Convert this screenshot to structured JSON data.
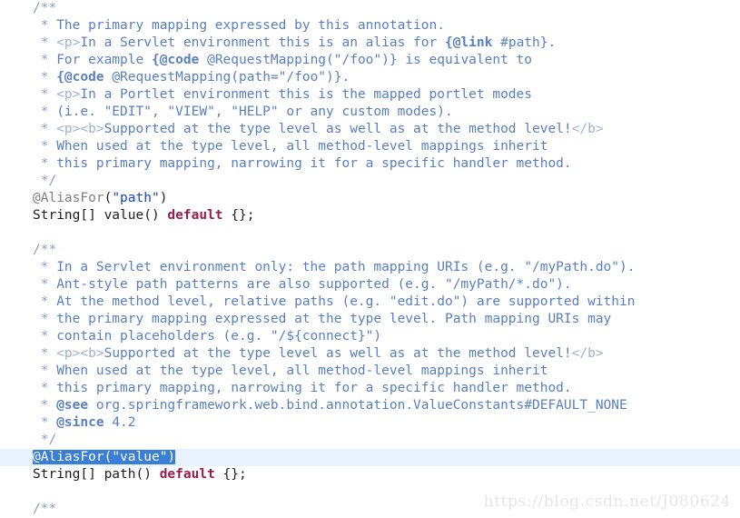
{
  "editor": {
    "language": "java",
    "background_color": "#ffffff",
    "current_line_highlight_color": "#e8f2fd",
    "selection_color": "#3a7fd5",
    "lines": [
      {
        "indent": 1,
        "segments": [
          {
            "cls": "cmt-delim",
            "text": "/**"
          }
        ]
      },
      {
        "indent": 1,
        "segments": [
          {
            "cls": "cmt-delim",
            "text": " * "
          },
          {
            "cls": "cmt",
            "text": "The primary mapping expressed by this annotation."
          }
        ]
      },
      {
        "indent": 1,
        "segments": [
          {
            "cls": "cmt-delim",
            "text": " * "
          },
          {
            "cls": "cmt-html",
            "text": "<p>"
          },
          {
            "cls": "cmt",
            "text": "In a Servlet environment this is an alias for "
          },
          {
            "cls": "cmt-tag",
            "text": "{@link"
          },
          {
            "cls": "cmt",
            "text": " #path}."
          }
        ]
      },
      {
        "indent": 1,
        "segments": [
          {
            "cls": "cmt-delim",
            "text": " * "
          },
          {
            "cls": "cmt",
            "text": "For example "
          },
          {
            "cls": "cmt-tag",
            "text": "{@code"
          },
          {
            "cls": "cmt",
            "text": " @RequestMapping(\"/foo\")} is equivalent to"
          }
        ]
      },
      {
        "indent": 1,
        "segments": [
          {
            "cls": "cmt-delim",
            "text": " * "
          },
          {
            "cls": "cmt-tag",
            "text": "{@code"
          },
          {
            "cls": "cmt",
            "text": " @RequestMapping(path=\"/foo\")}."
          }
        ]
      },
      {
        "indent": 1,
        "segments": [
          {
            "cls": "cmt-delim",
            "text": " * "
          },
          {
            "cls": "cmt-html",
            "text": "<p>"
          },
          {
            "cls": "cmt",
            "text": "In a Portlet environment this is the mapped portlet modes"
          }
        ]
      },
      {
        "indent": 1,
        "segments": [
          {
            "cls": "cmt-delim",
            "text": " * "
          },
          {
            "cls": "cmt",
            "text": "(i.e. \"EDIT\", \"VIEW\", \"HELP\" or any custom modes)."
          }
        ]
      },
      {
        "indent": 1,
        "segments": [
          {
            "cls": "cmt-delim",
            "text": " * "
          },
          {
            "cls": "cmt-html",
            "text": "<p><b>"
          },
          {
            "cls": "cmt",
            "text": "Supported at the type level as well as at the method level!"
          },
          {
            "cls": "cmt-html",
            "text": "</b>"
          }
        ]
      },
      {
        "indent": 1,
        "segments": [
          {
            "cls": "cmt-delim",
            "text": " * "
          },
          {
            "cls": "cmt",
            "text": "When used at the type level, all method-level mappings inherit"
          }
        ]
      },
      {
        "indent": 1,
        "segments": [
          {
            "cls": "cmt-delim",
            "text": " * "
          },
          {
            "cls": "cmt",
            "text": "this primary mapping, narrowing it for a specific handler method."
          }
        ]
      },
      {
        "indent": 1,
        "segments": [
          {
            "cls": "cmt-delim",
            "text": " */"
          }
        ]
      },
      {
        "indent": 0,
        "segments": [
          {
            "cls": "anno",
            "text": "@AliasFor"
          },
          {
            "cls": "punct",
            "text": "("
          },
          {
            "cls": "str",
            "text": "\"path\""
          },
          {
            "cls": "punct",
            "text": ")"
          }
        ]
      },
      {
        "indent": 0,
        "segments": [
          {
            "cls": "plain",
            "text": "String[] value() "
          },
          {
            "cls": "kw",
            "text": "default"
          },
          {
            "cls": "plain",
            "text": " {};"
          }
        ]
      },
      {
        "indent": 0,
        "segments": [
          {
            "cls": "plain",
            "text": ""
          }
        ]
      },
      {
        "indent": 1,
        "segments": [
          {
            "cls": "cmt-delim",
            "text": "/**"
          }
        ]
      },
      {
        "indent": 1,
        "segments": [
          {
            "cls": "cmt-delim",
            "text": " * "
          },
          {
            "cls": "cmt",
            "text": "In a Servlet environment only: the path mapping URIs (e.g. \"/myPath.do\")."
          }
        ]
      },
      {
        "indent": 1,
        "segments": [
          {
            "cls": "cmt-delim",
            "text": " * "
          },
          {
            "cls": "cmt",
            "text": "Ant-style path patterns are also supported (e.g. \"/myPath/*.do\")."
          }
        ]
      },
      {
        "indent": 1,
        "segments": [
          {
            "cls": "cmt-delim",
            "text": " * "
          },
          {
            "cls": "cmt",
            "text": "At the method level, relative paths (e.g. \"edit.do\") are supported within"
          }
        ]
      },
      {
        "indent": 1,
        "segments": [
          {
            "cls": "cmt-delim",
            "text": " * "
          },
          {
            "cls": "cmt",
            "text": "the primary mapping expressed at the type level. Path mapping URIs may"
          }
        ]
      },
      {
        "indent": 1,
        "segments": [
          {
            "cls": "cmt-delim",
            "text": " * "
          },
          {
            "cls": "cmt",
            "text": "contain placeholders (e.g. \"/${connect}\")"
          }
        ]
      },
      {
        "indent": 1,
        "segments": [
          {
            "cls": "cmt-delim",
            "text": " * "
          },
          {
            "cls": "cmt-html",
            "text": "<p><b>"
          },
          {
            "cls": "cmt",
            "text": "Supported at the type level as well as at the method level!"
          },
          {
            "cls": "cmt-html",
            "text": "</b>"
          }
        ]
      },
      {
        "indent": 1,
        "segments": [
          {
            "cls": "cmt-delim",
            "text": " * "
          },
          {
            "cls": "cmt",
            "text": "When used at the type level, all method-level mappings inherit"
          }
        ]
      },
      {
        "indent": 1,
        "segments": [
          {
            "cls": "cmt-delim",
            "text": " * "
          },
          {
            "cls": "cmt",
            "text": "this primary mapping, narrowing it for a specific handler method."
          }
        ]
      },
      {
        "indent": 1,
        "segments": [
          {
            "cls": "cmt-delim",
            "text": " * "
          },
          {
            "cls": "cmt-tag",
            "text": "@see"
          },
          {
            "cls": "cmt",
            "text": " org.springframework.web.bind.annotation.ValueConstants#DEFAULT_NONE"
          }
        ]
      },
      {
        "indent": 1,
        "segments": [
          {
            "cls": "cmt-delim",
            "text": " * "
          },
          {
            "cls": "cmt-tag",
            "text": "@since"
          },
          {
            "cls": "cmt",
            "text": " 4.2"
          }
        ]
      },
      {
        "indent": 1,
        "segments": [
          {
            "cls": "cmt-delim",
            "text": " */"
          }
        ]
      },
      {
        "indent": 0,
        "current": true,
        "selected": true,
        "segments": [
          {
            "cls": "anno",
            "text": "@AliasFor"
          },
          {
            "cls": "punct",
            "text": "("
          },
          {
            "cls": "str",
            "text": "\"value\""
          },
          {
            "cls": "punct",
            "text": ")"
          }
        ]
      },
      {
        "indent": 0,
        "segments": [
          {
            "cls": "plain",
            "text": "String[] path() "
          },
          {
            "cls": "kw",
            "text": "default"
          },
          {
            "cls": "plain",
            "text": " {};"
          }
        ]
      },
      {
        "indent": 0,
        "segments": [
          {
            "cls": "plain",
            "text": ""
          }
        ]
      },
      {
        "indent": 1,
        "segments": [
          {
            "cls": "cmt-delim",
            "text": "/**"
          }
        ]
      }
    ]
  },
  "watermark": {
    "text": "https://blog.csdn.net/J080624"
  }
}
